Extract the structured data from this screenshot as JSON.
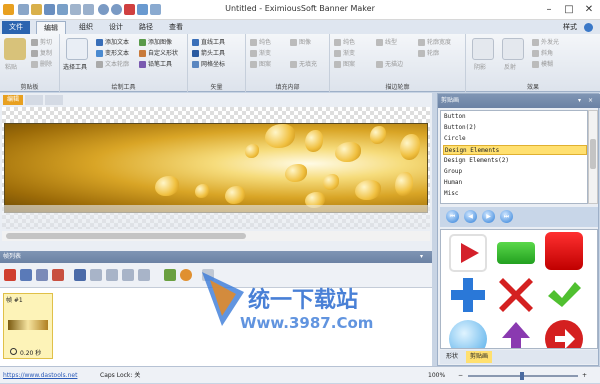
{
  "window": {
    "title": "Untitled - EximiousSoft Banner Maker",
    "controls": [
      "–",
      "□",
      "✕"
    ]
  },
  "ribbon_tabs": [
    "文件",
    "编辑",
    "组织",
    "设计",
    "路径",
    "查看"
  ],
  "style_label": "样式",
  "ribbon": {
    "clipboard": {
      "paste": "粘贴",
      "cut": "剪切",
      "copy": "复制",
      "delete": "删除",
      "label": "剪贴板"
    },
    "draw_tools": {
      "select": "选择工具",
      "add_text": "添加文本",
      "add_image": "添加图像",
      "warp_text": "变形文本",
      "custom_shape": "自定义形状",
      "text_outline": "文本轮廓",
      "shape_tool": "铅笔工具",
      "label": "绘制工具"
    },
    "lines": {
      "line": "直线工具",
      "arrow": "箭头工具",
      "grid": "网格坐标",
      "label": "矢量"
    },
    "fill": {
      "label": "填充内部",
      "items": [
        "纯色",
        "渐变",
        "图案",
        "图像",
        "无填充"
      ]
    },
    "stroke": {
      "label": "描边轮廓",
      "items": [
        "纯色",
        "渐变",
        "图案",
        "线型",
        "轮廓宽度",
        "无描边",
        "轮廓"
      ]
    },
    "effects": {
      "label": "效果",
      "items": [
        "阴影",
        "反射",
        "外发光",
        "斜角",
        "模糊"
      ]
    }
  },
  "editor": {
    "tab": "编辑"
  },
  "frames": {
    "title": "帧列表",
    "frame_label": "帧 #1",
    "frame_time": "0.20 秒"
  },
  "status": {
    "link": "https://www.dastools.net",
    "caps": "Caps Lock: 关",
    "zoom": "100%"
  },
  "clip": {
    "title": "剪贴画",
    "items": [
      "Button",
      "Button(2)",
      "Circle",
      "Design Elements",
      "Design Elements(2)",
      "Group",
      "Human",
      "Misc"
    ],
    "selected": "Design Elements",
    "tabs": [
      "形状",
      "剪贴画"
    ]
  },
  "watermark": {
    "line1": "统一下载站",
    "line2": "Www.3987.Com"
  }
}
